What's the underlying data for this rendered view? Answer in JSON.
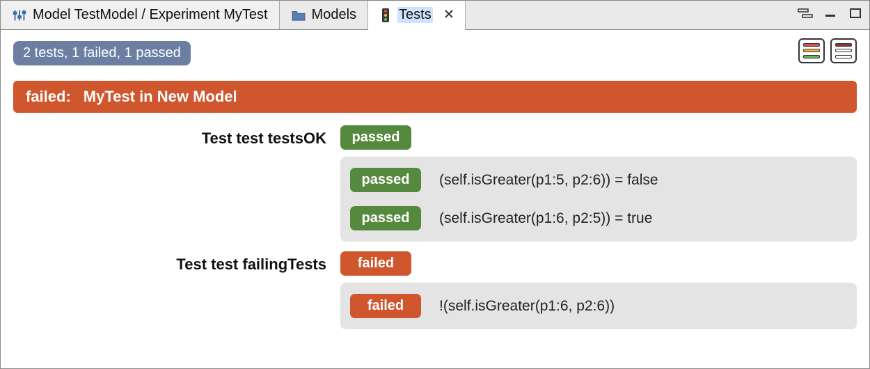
{
  "tabs": {
    "breadcrumb": "Model TestModel / Experiment MyTest",
    "models": "Models",
    "tests": "Tests"
  },
  "summary": "2 tests, 1 failed, 1 passed",
  "failedHeader": {
    "prefix": "failed:",
    "title": "MyTest in New Model"
  },
  "badges": {
    "passed": "passed",
    "failed": "failed"
  },
  "tests": [
    {
      "name": "Test test testsOK",
      "status": "passed",
      "assertions": [
        {
          "status": "passed",
          "text": "(self.isGreater(p1:5, p2:6)) = false"
        },
        {
          "status": "passed",
          "text": "(self.isGreater(p1:6, p2:5)) = true"
        }
      ]
    },
    {
      "name": "Test test failingTests",
      "status": "failed",
      "assertions": [
        {
          "status": "failed",
          "text": "!(self.isGreater(p1:6, p2:6))"
        }
      ]
    }
  ],
  "colors": {
    "passed": "#55893e",
    "failed": "#cf562d",
    "summary": "#6c7fa3"
  }
}
